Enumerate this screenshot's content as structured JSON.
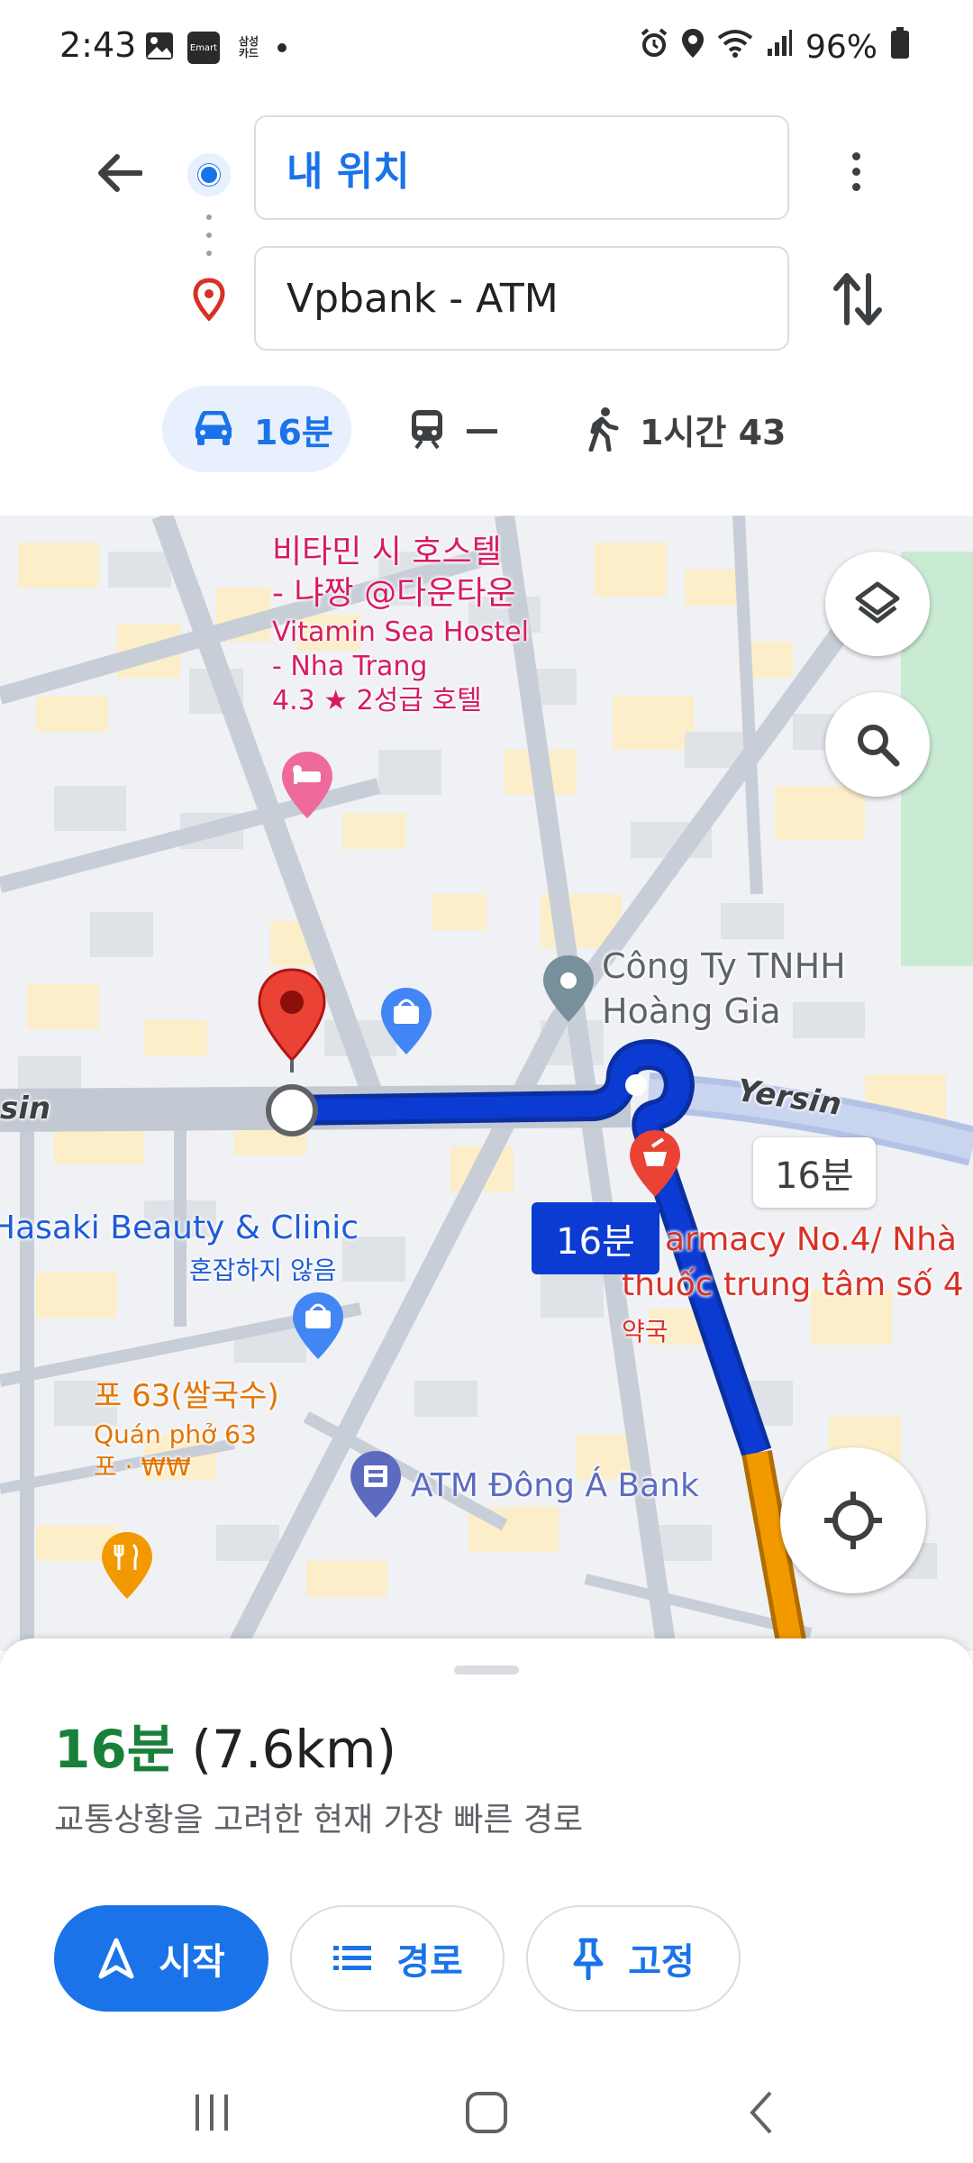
{
  "status_bar": {
    "time": "2:43",
    "left_icons": [
      "gallery-icon",
      "emart-icon",
      "samsung-card-icon",
      "dot-icon"
    ],
    "emart_label": "Emart",
    "samsung_card_label": "삼성\n카드",
    "battery": "96%",
    "right_icons": [
      "alarm-icon",
      "location-icon",
      "wifi-icon",
      "signal-icon",
      "battery-icon"
    ]
  },
  "directions": {
    "origin": "내 위치",
    "destination": "Vpbank - ATM"
  },
  "modes": {
    "car": "16분",
    "transit": "—",
    "walk": "1시간 43"
  },
  "map": {
    "hostel_name_ko_1": "비타민 시 호스텔",
    "hostel_name_ko_2": "- 냐짱 @다운타운",
    "hostel_name_en_1": "Vitamin Sea Hostel",
    "hostel_name_en_2": "- Nha Trang",
    "hostel_rating": "4.3 ★ 2성급 호텔",
    "company_1": "Công Ty TNHH",
    "company_2": "Hoàng Gia",
    "road_yersin": "Yersin",
    "road_yersin_left": "sin",
    "eta_chip_route": "16분",
    "eta_chip_alt": "16분",
    "hasaki": "Hasaki Beauty & Clinic",
    "hasaki_status": "혼잡하지 않음",
    "pharmacy_1": "armacy No.4/ Nhà",
    "pharmacy_2": "thuốc trung tâm số 4",
    "pharmacy_type": "약국",
    "pho_ko": "포 63(쌀국수)",
    "pho_vi": "Quán phở 63",
    "pho_meta": "포 · ₩₩",
    "atm": "ATM Đông Á Bank"
  },
  "sheet": {
    "time": "16분",
    "distance": "(7.6km)",
    "description": "교통상황을 고려한 현재 가장 빠른 경로",
    "start_label": "시작",
    "steps_label": "경로",
    "pin_label": "고정"
  },
  "colors": {
    "route_blue": "#0b3bd3",
    "accent_blue": "#1a73e8",
    "traffic_orange": "#f29900",
    "time_green": "#188038",
    "pin_red": "#d93025"
  }
}
